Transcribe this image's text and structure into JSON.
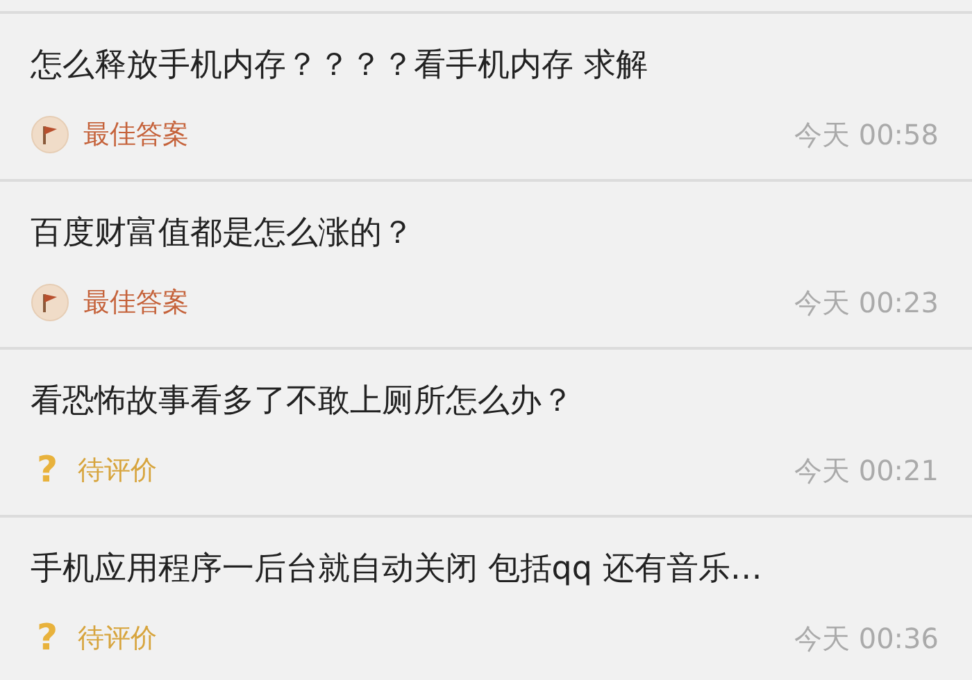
{
  "questions": [
    {
      "title": "怎么释放手机内存？？？？看手机内存 求解",
      "kind": "best",
      "status": "最佳答案",
      "time": "今天 00:58"
    },
    {
      "title": "百度财富值都是怎么涨的？",
      "kind": "best",
      "status": "最佳答案",
      "time": "今天 00:23"
    },
    {
      "title": "看恐怖故事看多了不敢上厕所怎么办？",
      "kind": "pending",
      "icon": "?",
      "status": "待评价",
      "time": "今天 00:21"
    },
    {
      "title": "手机应用程序一后台就自动关闭 包括qq 还有音乐…",
      "kind": "pending",
      "icon": "?",
      "status": "待评价",
      "time": "今天 00:36"
    }
  ]
}
